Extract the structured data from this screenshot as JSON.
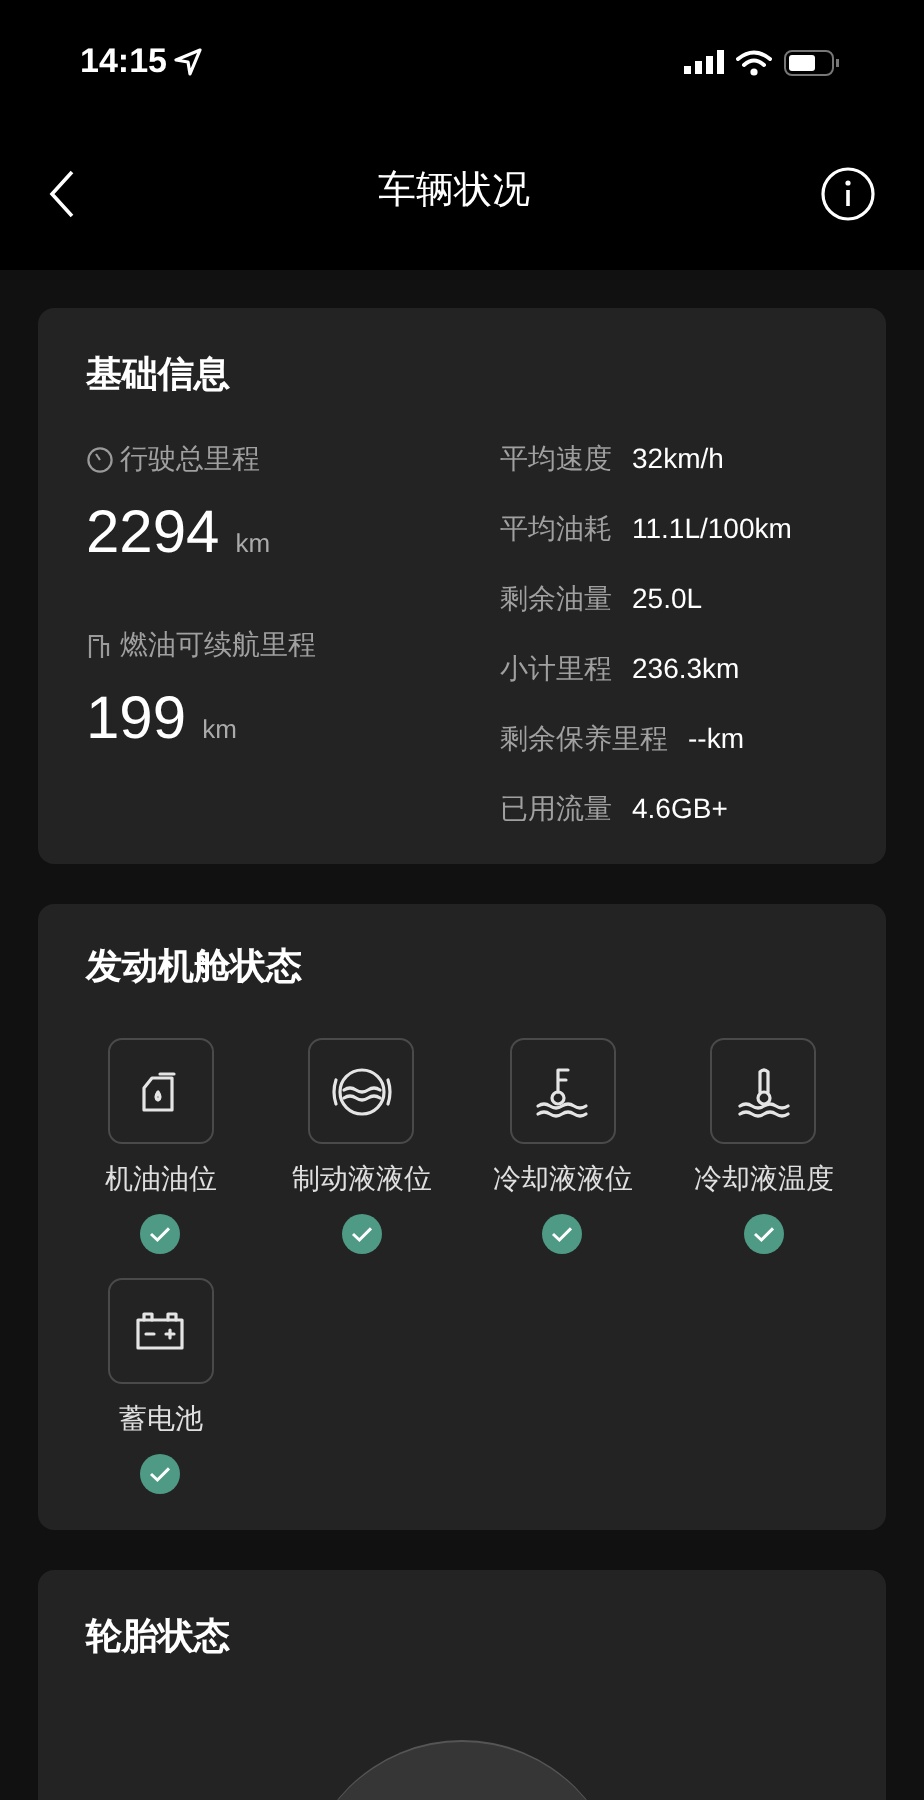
{
  "status_bar": {
    "time": "14:15"
  },
  "nav": {
    "title": "车辆状况"
  },
  "basic_info": {
    "title": "基础信息",
    "primary": [
      {
        "kind": "odometer",
        "label": "行驶总里程",
        "value": "2294",
        "unit": "km"
      },
      {
        "kind": "fuel",
        "label": "燃油可续航里程",
        "value": "199",
        "unit": "km"
      }
    ],
    "stats": [
      {
        "label": "平均速度",
        "value": "32km/h"
      },
      {
        "label": "平均油耗",
        "value": "11.1L/100km"
      },
      {
        "label": "剩余油量",
        "value": "25.0L"
      },
      {
        "label": "小计里程",
        "value": "236.3km"
      },
      {
        "label": "剩余保养里程",
        "value": "--km"
      },
      {
        "label": "已用流量",
        "value": "4.6GB+"
      }
    ]
  },
  "engine": {
    "title": "发动机舱状态",
    "items": [
      {
        "kind": "oil",
        "label": "机油油位",
        "ok": true
      },
      {
        "kind": "brake",
        "label": "制动液液位",
        "ok": true
      },
      {
        "kind": "coolant_level",
        "label": "冷却液液位",
        "ok": true
      },
      {
        "kind": "coolant_temp",
        "label": "冷却液温度",
        "ok": true
      },
      {
        "kind": "battery",
        "label": "蓄电池",
        "ok": true
      }
    ]
  },
  "tires": {
    "title": "轮胎状态"
  }
}
